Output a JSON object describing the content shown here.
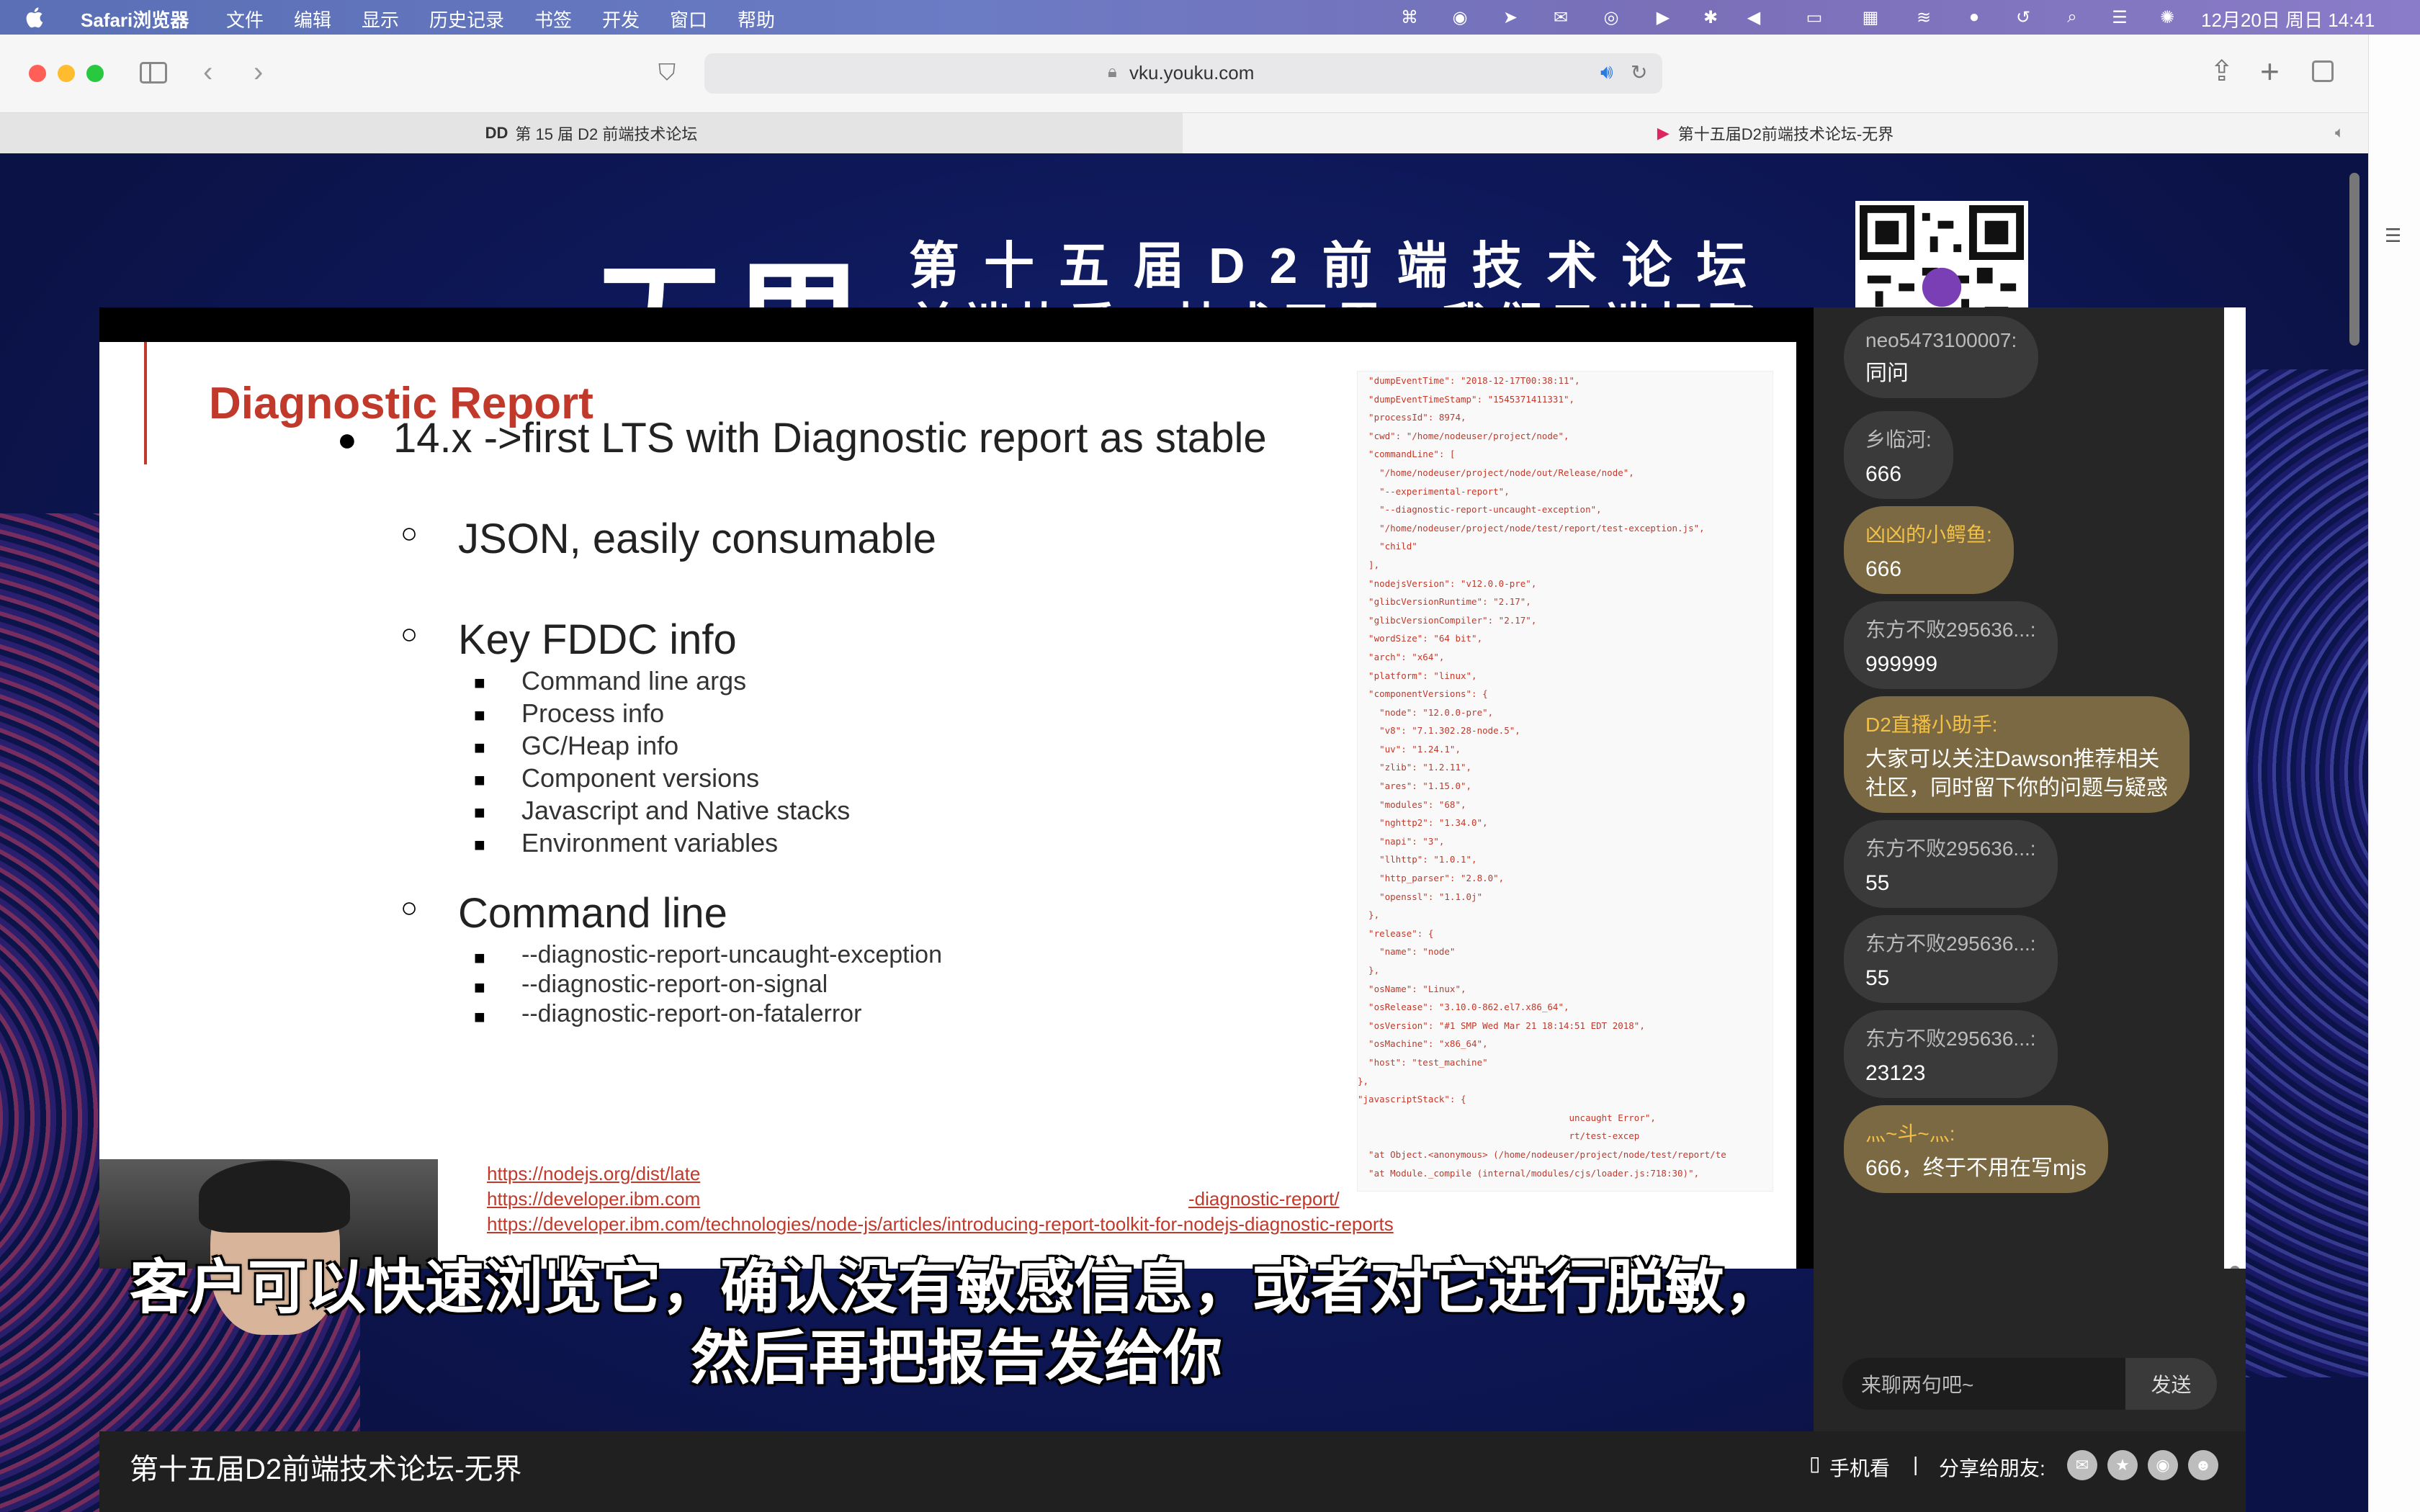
{
  "menubar": {
    "app": "Safari浏览器",
    "items": [
      "文件",
      "编辑",
      "显示",
      "历史记录",
      "书签",
      "开发",
      "窗口",
      "帮助"
    ],
    "datetime": "12月20日 周日  14:41"
  },
  "browser": {
    "url": "vku.youku.com",
    "tabs": [
      {
        "title": "第 15 届 D2 前端技术论坛"
      },
      {
        "title": "第十五届D2前端技术论坛-无界"
      }
    ]
  },
  "banner": {
    "logo": "无界",
    "line1": "第十五届D2前端技术论坛",
    "line2": "前端热爱，技术无界，我们云端相聚"
  },
  "slide": {
    "title": "Diagnostic Report",
    "bullet1": "14.x ->first LTS with Diagnostic report as stable",
    "sub1": "JSON, easily consumable",
    "sub2": "Key FDDC info",
    "sub2_items": [
      "Command line args",
      "Process info",
      "GC/Heap info",
      "Component versions",
      "Javascript and Native stacks",
      "Environment variables"
    ],
    "sub3": "Command line",
    "sub3_items": [
      "--diagnostic-report-uncaught-exception",
      "--diagnostic-report-on-signal",
      "--diagnostic-report-on-fatalerror"
    ],
    "links": [
      "https://nodejs.org/dist/late",
      "https://developer.ibm.com",
      "https://developer.ibm.com/technologies/node-js/articles/introducing-report-toolkit-for-nodejs-diagnostic-reports"
    ],
    "link2_tail": "-diagnostic-report/",
    "json_lines": [
      "  \"dumpEventTime\": \"2018-12-17T00:38:11\",",
      "  \"dumpEventTimeStamp\": \"1545371411331\",",
      "  \"processId\": 8974,",
      "  \"cwd\": \"/home/nodeuser/project/node\",",
      "  \"commandLine\": [",
      "    \"/home/nodeuser/project/node/out/Release/node\",",
      "    \"--experimental-report\",",
      "    \"--diagnostic-report-uncaught-exception\",",
      "    \"/home/nodeuser/project/node/test/report/test-exception.js\",",
      "    \"child\"",
      "  ],",
      "  \"nodejsVersion\": \"v12.0.0-pre\",",
      "  \"glibcVersionRuntime\": \"2.17\",",
      "  \"glibcVersionCompiler\": \"2.17\",",
      "  \"wordSize\": \"64 bit\",",
      "  \"arch\": \"x64\",",
      "  \"platform\": \"linux\",",
      "  \"componentVersions\": {",
      "    \"node\": \"12.0.0-pre\",",
      "    \"v8\": \"7.1.302.28-node.5\",",
      "    \"uv\": \"1.24.1\",",
      "    \"zlib\": \"1.2.11\",",
      "    \"ares\": \"1.15.0\",",
      "    \"modules\": \"68\",",
      "    \"nghttp2\": \"1.34.0\",",
      "    \"napi\": \"3\",",
      "    \"llhttp\": \"1.0.1\",",
      "    \"http_parser\": \"2.8.0\",",
      "    \"openssl\": \"1.1.0j\"",
      "  },",
      "  \"release\": {",
      "    \"name\": \"node\"",
      "  },",
      "  \"osName\": \"Linux\",",
      "  \"osRelease\": \"3.10.0-862.el7.x86_64\",",
      "  \"osVersion\": \"#1 SMP Wed Mar 21 18:14:51 EDT 2018\",",
      "  \"osMachine\": \"x86_64\",",
      "  \"host\": \"test_machine\"",
      "},",
      "\"javascriptStack\": {",
      "                                       uncaught Error\",",
      "                                       rt/test-excep",
      "  \"at Object.<anonymous> (/home/nodeuser/project/node/test/report/te",
      "  \"at Module._compile (internal/modules/cjs/loader.js:718:30)\","
    ]
  },
  "subtitle": {
    "line1": "客户可以快速浏览它，确认没有敏感信息，或者对它进行脱敏，",
    "line2": "然后再把报告发给你"
  },
  "chat": {
    "messages": [
      {
        "user": "neo5473100007:",
        "text": "同问"
      },
      {
        "user": "乡临河:",
        "text": "666"
      },
      {
        "user": "凶凶的小鳄鱼:",
        "text": "666",
        "highlight": true
      },
      {
        "user": "东方不败295636...:",
        "text": "999999"
      },
      {
        "user": "D2直播小助手:",
        "text": "大家可以关注Dawson推荐相关",
        "text2": "社区，同时留下你的问题与疑惑",
        "highlight": true
      },
      {
        "user": "东方不败295636...:",
        "text": "55"
      },
      {
        "user": "东方不败295636...:",
        "text": "55"
      },
      {
        "user": "东方不败295636...:",
        "text": "23123"
      },
      {
        "user": "灬~斗~灬:",
        "text": "666，终于不用在写mjs",
        "highlight": true
      }
    ],
    "input_placeholder": "来聊两句吧~",
    "send_label": "发送"
  },
  "footer": {
    "video_title": "第十五届D2前端技术论坛-无界",
    "mobile_label": "手机看",
    "separator": "|",
    "share_label": "分享给朋友:"
  },
  "icons": {
    "apple": "apple-logo-icon",
    "share": "share-icon",
    "new_tab": "plus-icon",
    "tabs_overview": "tabs-icon",
    "sidebar": "sidebar-icon",
    "shield": "privacy-shield-icon",
    "lock": "lock-icon",
    "speaker": "speaker-icon",
    "reload": "reload-icon",
    "phone": "phone-icon"
  }
}
